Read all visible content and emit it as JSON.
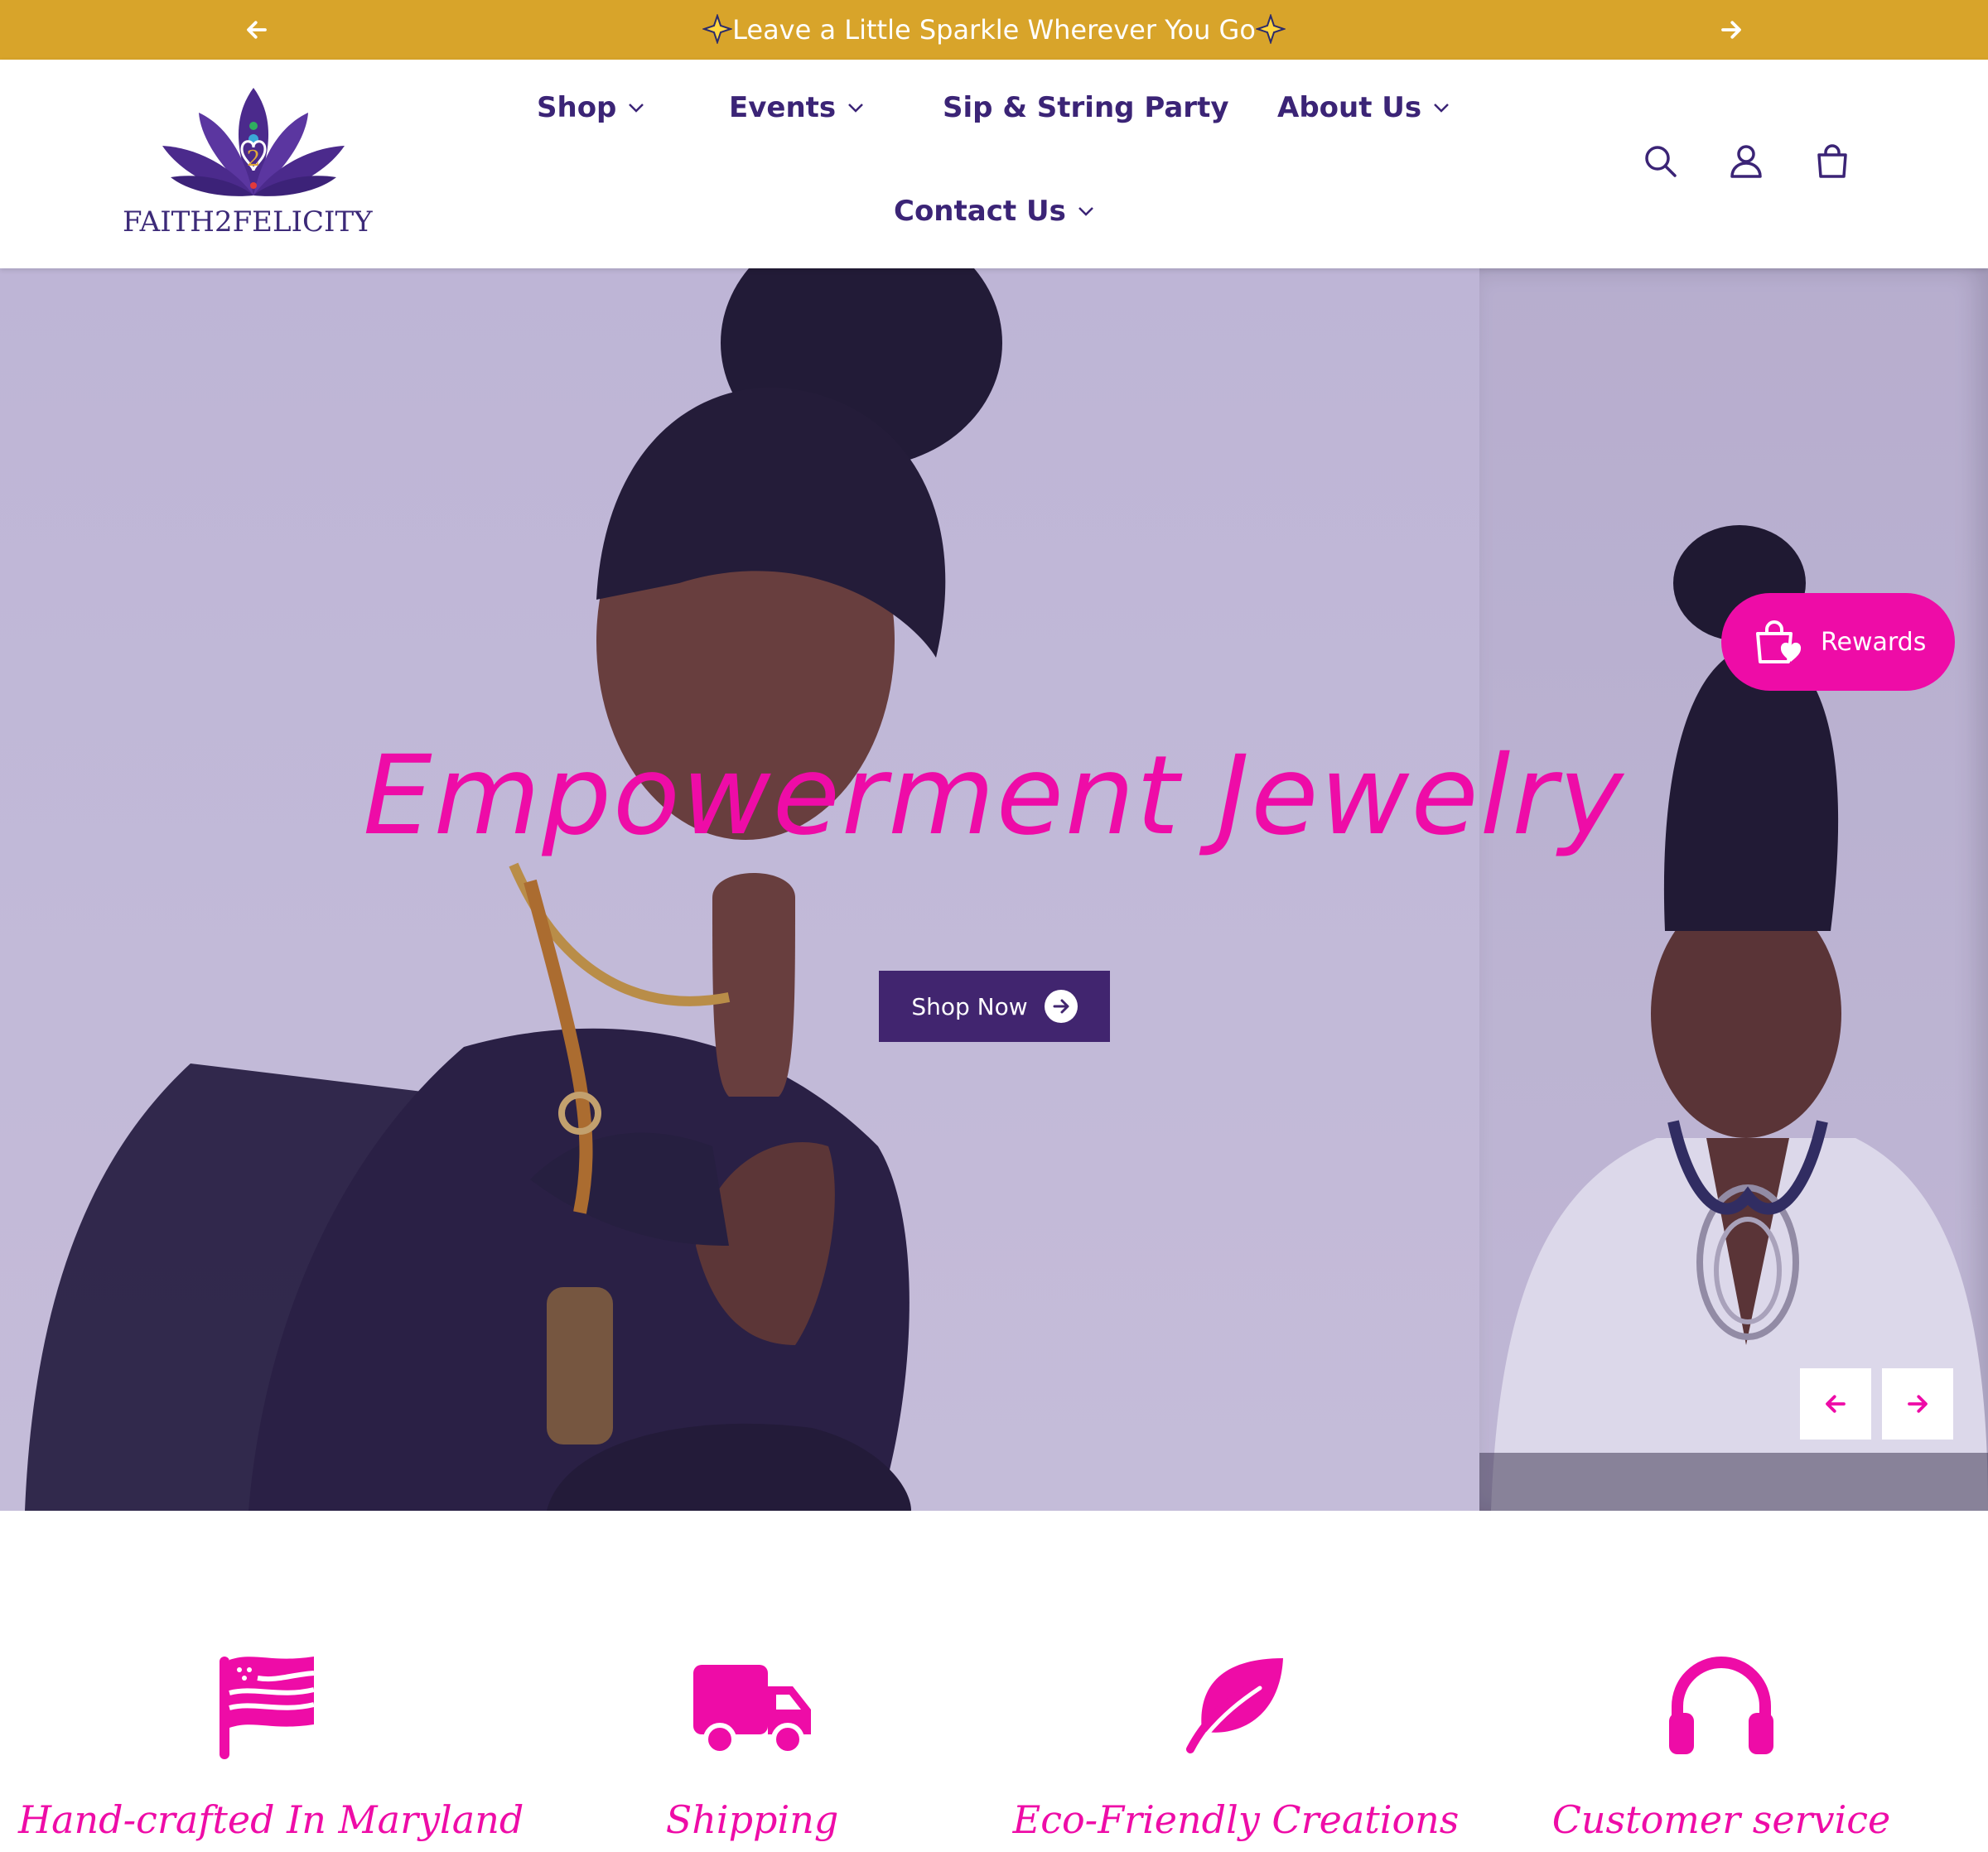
{
  "announcement": {
    "text": "Leave a Little Sparkle Wherever You Go",
    "prev_icon": "arrow-left-icon",
    "next_icon": "arrow-right-icon"
  },
  "header": {
    "logo_text": "FAITH2FELICITY",
    "logo_icon": "lotus-logo-icon",
    "nav": [
      {
        "label": "Shop",
        "has_dropdown": true
      },
      {
        "label": "Events",
        "has_dropdown": true
      },
      {
        "label": "Sip & String Party",
        "has_dropdown": false
      },
      {
        "label": "About Us",
        "has_dropdown": true
      },
      {
        "label": "Contact Us",
        "has_dropdown": true
      }
    ],
    "icons": [
      "search-icon",
      "account-icon",
      "cart-icon"
    ]
  },
  "hero": {
    "title": "Empowerment Jewelry",
    "button_label": "Shop Now",
    "button_icon": "arrow-right-circle-icon",
    "slider_prev_icon": "arrow-left-icon",
    "slider_next_icon": "arrow-right-icon"
  },
  "rewards": {
    "label": "Rewards",
    "icon": "shopping-bag-heart-icon"
  },
  "features": [
    {
      "label": "Hand-crafted In Maryland",
      "icon": "flag-icon"
    },
    {
      "label": "Shipping",
      "icon": "truck-icon"
    },
    {
      "label": "Eco-Friendly Creations",
      "icon": "leaf-icon"
    },
    {
      "label": "Customer service",
      "icon": "headphones-icon"
    }
  ],
  "colors": {
    "announcement_bg": "#d8a42a",
    "brand_purple": "#3b2476",
    "button_purple": "#41256f",
    "accent_pink": "#ee0ca7"
  }
}
